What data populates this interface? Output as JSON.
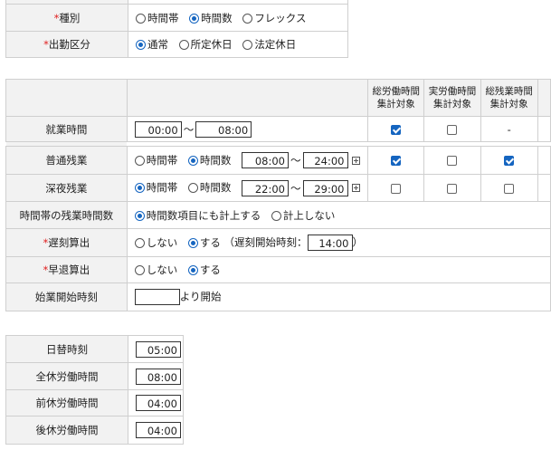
{
  "top_rows": [
    {
      "label": "種別",
      "required": true,
      "options": [
        {
          "label": "時間帯",
          "selected": false
        },
        {
          "label": "時間数",
          "selected": true
        },
        {
          "label": "フレックス",
          "selected": false
        }
      ]
    },
    {
      "label": "出勤区分",
      "required": true,
      "options": [
        {
          "label": "通常",
          "selected": true
        },
        {
          "label": "所定休日",
          "selected": false
        },
        {
          "label": "法定休日",
          "selected": false
        }
      ]
    }
  ],
  "work_table": {
    "headers": [
      {
        "line1": "総労働時間",
        "line2": "集計対象"
      },
      {
        "line1": "実労働時間",
        "line2": "集計対象"
      },
      {
        "line1": "総残業時間",
        "line2": "集計対象"
      }
    ],
    "working_hours": {
      "label": "就業時間",
      "from": "00:00",
      "sep": "～",
      "to": "08:00",
      "checks": [
        true,
        false
      ],
      "dash": "-"
    },
    "regular_overtime": {
      "label": "普通残業",
      "options": [
        {
          "label": "時間帯",
          "selected": false
        },
        {
          "label": "時間数",
          "selected": true
        }
      ],
      "from": "08:00",
      "sep": "～",
      "to": "24:00",
      "checks": [
        true,
        false,
        true
      ]
    },
    "late_night_overtime": {
      "label": "深夜残業",
      "options": [
        {
          "label": "時間帯",
          "selected": true
        },
        {
          "label": "時間数",
          "selected": false
        }
      ],
      "from": "22:00",
      "sep": "～",
      "to": "29:00",
      "checks": [
        false,
        false,
        false
      ]
    },
    "timeband_overtime": {
      "label": "時間帯の残業時間数",
      "options": [
        {
          "label": "時間数項目にも計上する",
          "selected": true
        },
        {
          "label": "計上しない",
          "selected": false
        }
      ]
    },
    "late_calc": {
      "label": "遅刻算出",
      "required": true,
      "options": [
        {
          "label": "しない",
          "selected": false
        },
        {
          "label": "する",
          "selected": true
        }
      ],
      "start_label": "（遅刻開始時刻：",
      "start_value": "14:00",
      "close": "）"
    },
    "early_calc": {
      "label": "早退算出",
      "required": true,
      "options": [
        {
          "label": "しない",
          "selected": false
        },
        {
          "label": "する",
          "selected": true
        }
      ]
    },
    "start_time": {
      "label": "始業開始時刻",
      "value": "",
      "suffix": "より開始"
    }
  },
  "day_table": [
    {
      "label": "日替時刻",
      "value": "05:00"
    },
    {
      "label": "全休労働時間",
      "value": "08:00"
    },
    {
      "label": "前休労働時間",
      "value": "04:00"
    },
    {
      "label": "後休労働時間",
      "value": "04:00"
    }
  ]
}
